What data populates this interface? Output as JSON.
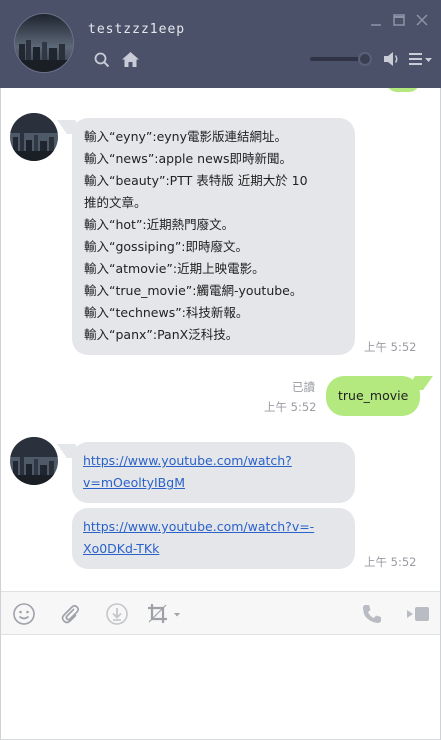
{
  "header": {
    "contact_name": "testzzz1eep"
  },
  "messages": [
    {
      "lines": [
        "輸入“eyny”:eyny電影版連結網址。",
        "輸入“news”:apple news即時新聞。",
        "輸入“beauty”:PTT 表特版 近期大於 10",
        "推的文章。",
        "輸入“hot”:近期熱門廢文。",
        "輸入“gossiping”:即時廢文。",
        "輸入“atmovie”:近期上映電影。",
        "輸入“true_movie”:觸電網-youtube。",
        "輸入“technews”:科技新報。",
        "輸入“panx”:PanX泛科技。"
      ],
      "time": "上午 5:52"
    },
    {
      "text": "true_movie",
      "read": "已讀",
      "time": "上午 5:52"
    },
    {
      "link1": [
        "https://www.youtube.com/watch?",
        "v=mOeoltyIBgM"
      ],
      "link2": [
        "https://www.youtube.com/watch?v=-",
        "Xo0DKd-TKk"
      ],
      "time": "上午 5:52"
    }
  ],
  "icons": {
    "search": "search-icon",
    "home": "home-icon",
    "speaker": "speaker-icon",
    "menu": "menu-icon",
    "emoji": "emoji-icon",
    "attach": "paperclip-icon",
    "download": "download-icon",
    "crop": "crop-icon",
    "call": "phone-icon",
    "video": "video-icon"
  },
  "colors": {
    "header_bg": "#4b5168",
    "incoming_bubble": "#e4e6ea",
    "outgoing_bubble": "#b3e97e",
    "link": "#2a62c9"
  }
}
